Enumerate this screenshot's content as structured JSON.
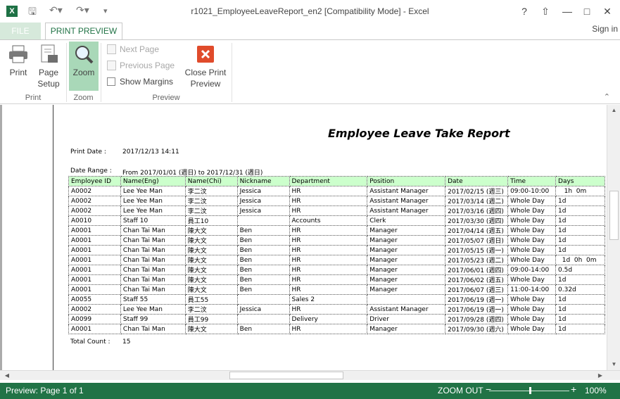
{
  "window": {
    "title": "r1021_EmployeeLeaveReport_en2  [Compatibility Mode] - Excel",
    "help": "?",
    "minimize": "—",
    "maximize": "□",
    "close": "✕"
  },
  "tabs": {
    "file": "FILE",
    "print_preview": "PRINT PREVIEW",
    "sign_in": "Sign in"
  },
  "ribbon": {
    "print": "Print",
    "page_setup_1": "Page",
    "page_setup_2": "Setup",
    "zoom": "Zoom",
    "next_page": "Next Page",
    "previous_page": "Previous Page",
    "show_margins": "Show Margins",
    "close_preview_1": "Close Print",
    "close_preview_2": "Preview",
    "group_print": "Print",
    "group_zoom": "Zoom",
    "group_preview": "Preview"
  },
  "report": {
    "title": "Employee Leave Take Report",
    "print_date_label": "Print Date :",
    "print_date_value": "2017/12/13 14:11",
    "date_range_label": "Date Range :",
    "date_range_value": "From 2017/01/01 (週日)  to  2017/12/31 (週日)",
    "total_count_label": "Total Count :",
    "total_count_value": "15",
    "columns": [
      "Employee ID",
      "Name(Eng)",
      "Name(Chi)",
      "Nickname",
      "Department",
      "Position",
      "Date",
      "Time",
      "Days"
    ],
    "rows": [
      [
        "A0002",
        "Lee Yee Man",
        "李二汶",
        "Jessica",
        "HR",
        "Assistant Manager",
        "2017/02/15 (週三)",
        "09:00-10:00",
        "   1h  0m"
      ],
      [
        "A0002",
        "Lee Yee Man",
        "李二汶",
        "Jessica",
        "HR",
        "Assistant Manager",
        "2017/03/14 (週二)",
        "Whole Day",
        "1d"
      ],
      [
        "A0002",
        "Lee Yee Man",
        "李二汶",
        "Jessica",
        "HR",
        "Assistant Manager",
        "2017/03/16 (週四)",
        "Whole Day",
        "1d"
      ],
      [
        "A0010",
        "Staff 10",
        "員工10",
        "",
        "Accounts",
        "Clerk",
        "2017/03/30 (週四)",
        "Whole Day",
        "1d"
      ],
      [
        "A0001",
        "Chan Tai Man",
        "陳大文",
        "Ben",
        "HR",
        "Manager",
        "2017/04/14 (週五)",
        "Whole Day",
        "1d"
      ],
      [
        "A0001",
        "Chan Tai Man",
        "陳大文",
        "Ben",
        "HR",
        "Manager",
        "2017/05/07 (週日)",
        "Whole Day",
        "1d"
      ],
      [
        "A0001",
        "Chan Tai Man",
        "陳大文",
        "Ben",
        "HR",
        "Manager",
        "2017/05/15 (週一)",
        "Whole Day",
        "1d"
      ],
      [
        "A0001",
        "Chan Tai Man",
        "陳大文",
        "Ben",
        "HR",
        "Manager",
        "2017/05/23 (週二)",
        "Whole Day",
        "  1d  0h  0m"
      ],
      [
        "A0001",
        "Chan Tai Man",
        "陳大文",
        "Ben",
        "HR",
        "Manager",
        "2017/06/01 (週四)",
        "09:00-14:00",
        "0.5d"
      ],
      [
        "A0001",
        "Chan Tai Man",
        "陳大文",
        "Ben",
        "HR",
        "Manager",
        "2017/06/02 (週五)",
        "Whole Day",
        "1d"
      ],
      [
        "A0001",
        "Chan Tai Man",
        "陳大文",
        "Ben",
        "HR",
        "Manager",
        "2017/06/07 (週三)",
        "11:00-14:00",
        "0.32d"
      ],
      [
        "A0055",
        "Staff 55",
        "員工55",
        "",
        "Sales 2",
        "",
        "2017/06/19 (週一)",
        "Whole Day",
        "1d"
      ],
      [
        "A0002",
        "Lee Yee Man",
        "李二汶",
        "Jessica",
        "HR",
        "Assistant Manager",
        "2017/06/19 (週一)",
        "Whole Day",
        "1d"
      ],
      [
        "A0099",
        "Staff 99",
        "員工99",
        "",
        "Delivery",
        "Driver",
        "2017/09/28 (週四)",
        "Whole Day",
        "1d"
      ],
      [
        "A0001",
        "Chan Tai Man",
        "陳大文",
        "Ben",
        "HR",
        "Manager",
        "2017/09/30 (週六)",
        "Whole Day",
        "1d"
      ]
    ]
  },
  "status": {
    "left": "Preview: Page 1 of 1",
    "zoom_out": "ZOOM OUT",
    "minus": "−",
    "plus": "+",
    "zoom_pct": "100%"
  },
  "colors": {
    "accent": "#217346",
    "zoom_active": "#a9d8b8",
    "header_row": "#ccffcc"
  }
}
